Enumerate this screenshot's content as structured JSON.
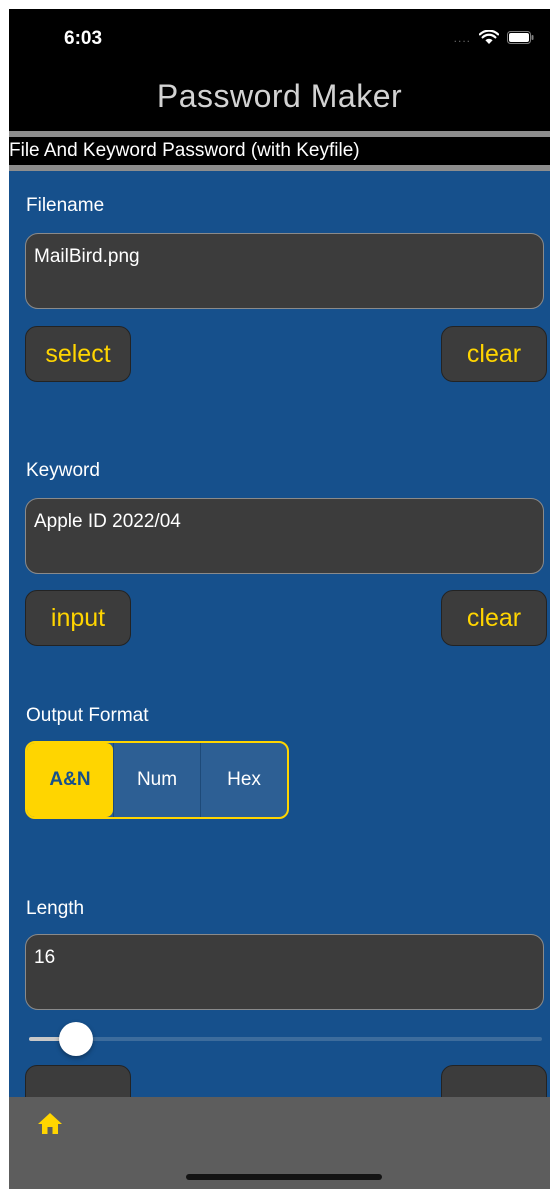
{
  "status_bar": {
    "time": "6:03",
    "signal_dots": "....",
    "wifi_icon": "wifi-icon",
    "battery_icon": "battery-icon"
  },
  "app": {
    "title": "Password Maker",
    "subtitle": "File And Keyword Password (with Keyfile)"
  },
  "filename": {
    "label": "Filename",
    "value": "MailBird.png",
    "select_label": "select",
    "clear_label": "clear"
  },
  "keyword": {
    "label": "Keyword",
    "value": "Apple ID 2022/04",
    "input_label": "input",
    "clear_label": "clear"
  },
  "output_format": {
    "label": "Output Format",
    "options": [
      "A&N",
      "Num",
      "Hex"
    ],
    "selected": "A&N"
  },
  "length": {
    "label": "Length",
    "value": "16",
    "slider_level": 0.08
  },
  "tab_bar": {
    "home_icon": "home-icon"
  },
  "colors": {
    "background": "#16508c",
    "accent": "#ffd500",
    "field": "#3c3c3c"
  }
}
